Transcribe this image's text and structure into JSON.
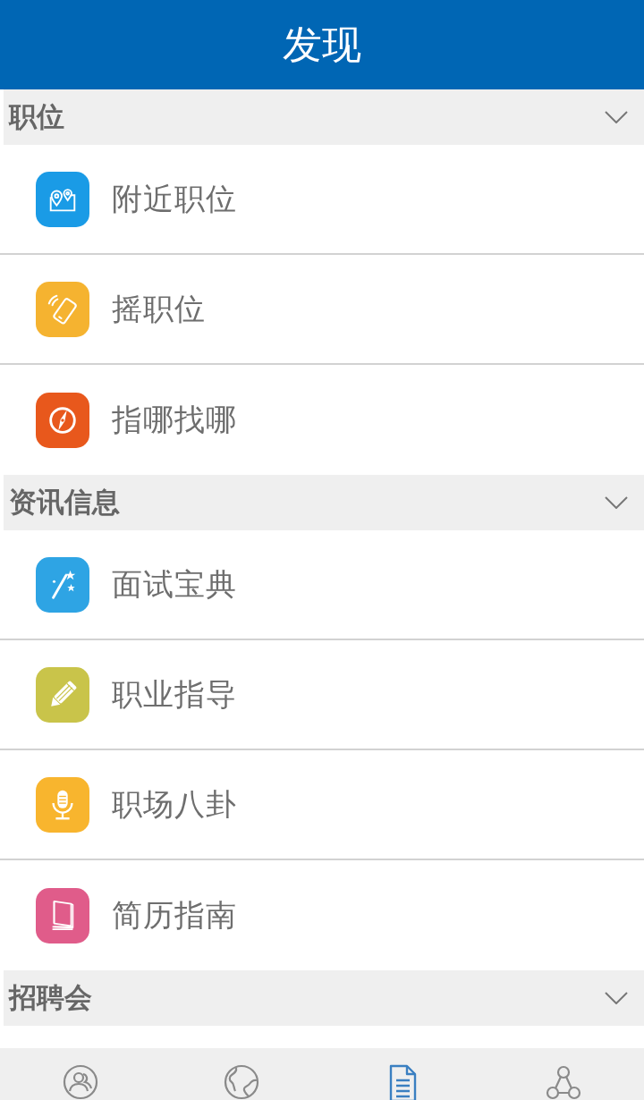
{
  "header": {
    "title": "发现"
  },
  "sections": [
    {
      "title": "职位",
      "items": [
        {
          "label": "附近职位",
          "color": "#1a9be6"
        },
        {
          "label": "摇职位",
          "color": "#f5b330"
        },
        {
          "label": "指哪找哪",
          "color": "#e8581c"
        }
      ]
    },
    {
      "title": "资讯信息",
      "items": [
        {
          "label": "面试宝典",
          "color": "#2ea4e4"
        },
        {
          "label": "职业指导",
          "color": "#c9c44a"
        },
        {
          "label": "职场八卦",
          "color": "#f8b52e"
        },
        {
          "label": "简历指南",
          "color": "#e05c8a"
        }
      ]
    },
    {
      "title": "招聘会"
    }
  ],
  "tab_bar": {
    "tabs": [
      {
        "selected": false
      },
      {
        "selected": false
      },
      {
        "selected": true
      },
      {
        "selected": false
      }
    ]
  }
}
